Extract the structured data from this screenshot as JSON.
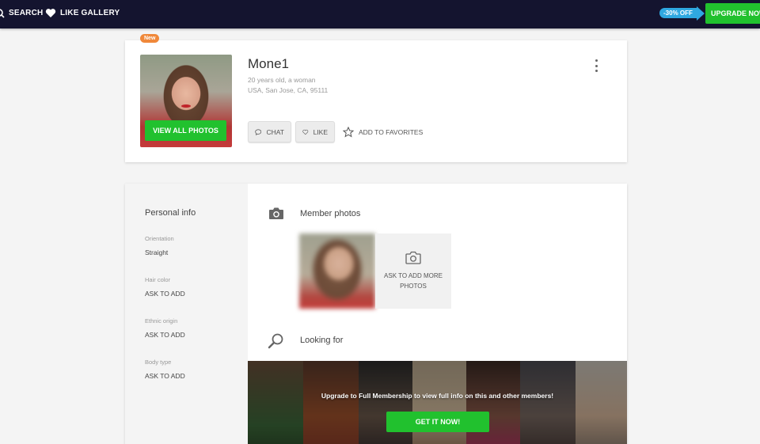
{
  "topbar": {
    "search_label": "SEARCH",
    "like_gallery_label": "LIKE GALLERY",
    "discount_label": "-30% OFF",
    "upgrade_label": "UPGRADE NOW",
    "accent_color": "#21c12e",
    "discount_color": "#2fa8e0"
  },
  "profile": {
    "badge": "New",
    "name": "Mone1",
    "age_line": "20 years old, a woman",
    "location": "USA, San Jose, CA, 95111",
    "view_photos_label": "VIEW ALL PHOTOS",
    "chat_label": "CHAT",
    "like_label": "LIKE",
    "favorites_label": "ADD TO FAVORITES"
  },
  "personal_info": {
    "title": "Personal info",
    "fields": [
      {
        "label": "Orientation",
        "value": "Straight"
      },
      {
        "label": "Hair color",
        "value": "ASK TO ADD"
      },
      {
        "label": "Ethnic origin",
        "value": "ASK TO ADD"
      },
      {
        "label": "Body type",
        "value": "ASK TO ADD"
      }
    ]
  },
  "member_photos": {
    "title": "Member photos",
    "ask_label": "ASK TO ADD MORE PHOTOS"
  },
  "looking_for": {
    "title": "Looking for",
    "banner_text": "Upgrade to Full Membership to view full info on this and other members!",
    "cta_label": "GET IT NOW!"
  }
}
